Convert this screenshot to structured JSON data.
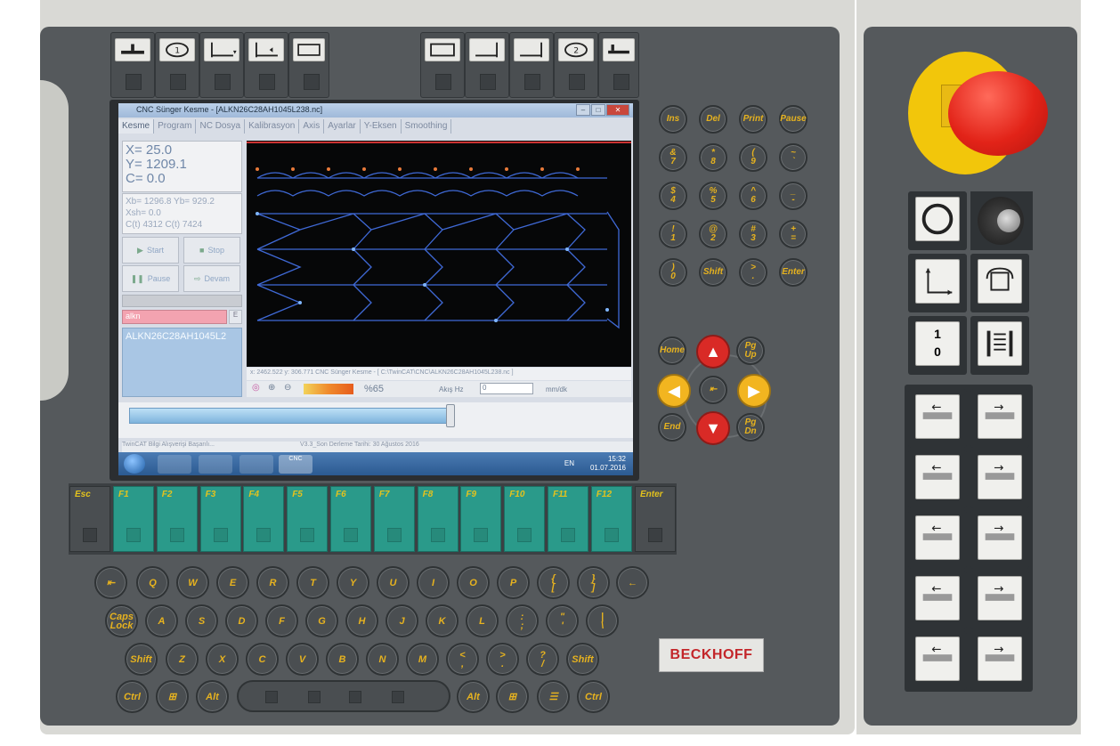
{
  "window": {
    "title": "CNC Sünger Kesme - [ALKN26C28AH1045L238.nc]"
  },
  "tabs": [
    "Kesme",
    "Program",
    "NC Dosya",
    "Kalibrasyon",
    "Axis",
    "Ayarlar",
    "Y-Eksen",
    "Smoothing"
  ],
  "position": {
    "x": "X= 25.0",
    "y": "Y= 1209.1",
    "c": "C= 0.0"
  },
  "secondary": {
    "line1": "Xb= 1296.8  Yb= 929.2",
    "line2": "Xsh= 0.0",
    "line3": "C(t) 4312    C(t) 7424"
  },
  "controls": {
    "start": "Start",
    "stop": "Stop",
    "pause": "Pause",
    "next": "Devam"
  },
  "program_input": {
    "value": "alkn",
    "button": "E"
  },
  "program_name": "ALKN26C28AH1045L2",
  "status_line": "x: 2462.522 y: 306.771    CNC Sünger Kesme - [ C:\\TwinCAT\\CNC\\ALKN26C28AH1045L238.nc ]",
  "zoom": {
    "percent": "%65",
    "feed_label": "Akış Hz",
    "feed_value": "0",
    "feed_unit": "mm/dk"
  },
  "info": {
    "left": "TwinCAT Bilgi Alışverişi Başarılı...",
    "right": "V3.3_Son Derleme Tarihi: 30 Ağustos 2016"
  },
  "taskbar": {
    "app": "CNC",
    "lang": "EN",
    "time": "15:32",
    "date": "01.07.2016"
  },
  "right_keys": [
    "Ins",
    "Del",
    "Print",
    "Pause",
    "&\n7",
    "*\n8",
    "(\n9",
    "~\n`",
    "$\n4",
    "%\n5",
    "^\n6",
    "_\n-",
    "!\n1",
    "@\n2",
    "#\n3",
    "+\n=",
    ")\n0",
    "Shift",
    ">\n.",
    "Enter"
  ],
  "nav_keys": {
    "home": "Home",
    "pgup": "Pg Up",
    "end": "End",
    "pgdn": "Pg Dn"
  },
  "fkeys": {
    "esc": "Esc",
    "enter": "Enter",
    "f": [
      "F1",
      "F2",
      "F3",
      "F4",
      "F5",
      "F6",
      "F7",
      "F8",
      "F9",
      "F10",
      "F11",
      "F12"
    ]
  },
  "kb_row1": [
    "Q",
    "W",
    "E",
    "R",
    "T",
    "Y",
    "U",
    "I",
    "O",
    "P",
    "{\n[",
    "}\n]"
  ],
  "kb_row2": [
    "A",
    "S",
    "D",
    "F",
    "G",
    "H",
    "J",
    "K",
    "L",
    ":\n;",
    "\"\n'",
    "|\n\\"
  ],
  "kb_row3": [
    "Z",
    "X",
    "C",
    "V",
    "B",
    "N",
    "M",
    "<\n,",
    ">\n.",
    "?\n/"
  ],
  "mods": {
    "caps": "Caps\nLock",
    "shift_l": "Shift",
    "shift_r": "Shift",
    "ctrl_l": "Ctrl",
    "alt_l": "Alt",
    "alt_r": "Alt",
    "ctrl_r": "Ctrl"
  },
  "brand": "BECKHOFF",
  "panel_key_onoff": {
    "top": "1",
    "bottom": "0"
  },
  "colors": {
    "teal": "#2a9a8a",
    "key_yellow": "#e6b21f",
    "estop_red": "#e22318",
    "brand_red": "#c3262a"
  }
}
